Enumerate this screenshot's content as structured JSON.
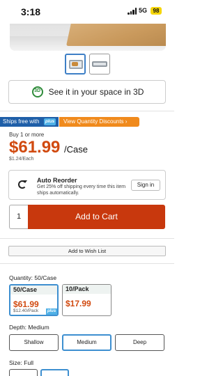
{
  "status_bar": {
    "time": "3:18",
    "network": "5G",
    "battery": "98"
  },
  "view3d": {
    "label": "See it in your space in 3D",
    "icon": "cube-3d-icon",
    "icon_text": "3D"
  },
  "shipping": {
    "ships_free_label": "Ships free with",
    "plus_label": "plus",
    "qty_discount_label": "View Quantity Discounts ›"
  },
  "pricing": {
    "buy_label": "Buy 1 or more",
    "price": "$61.99",
    "unit": "/Case",
    "each": "$1.24/Each"
  },
  "auto_reorder": {
    "title": "Auto Reorder",
    "description": "Get 25% off shipping every time this item ships automatically.",
    "sign_in_label": "Sign in"
  },
  "cart": {
    "quantity": "1",
    "add_to_cart_label": "Add to Cart"
  },
  "wish_list_label": "Add to Wish List",
  "quantity_options": {
    "label": "Quantity:",
    "selected_value": "50/Case",
    "options": [
      {
        "name": "50/Case",
        "price": "$61.99",
        "sub": "$12.40/Pack",
        "plus": "plus"
      },
      {
        "name": "10/Pack",
        "price": "$17.99",
        "sub": ""
      }
    ]
  },
  "depth_options": {
    "label": "Depth:",
    "selected_value": "Medium",
    "options": [
      "Shallow",
      "Medium",
      "Deep"
    ]
  },
  "size_options": {
    "label": "Size:",
    "selected_value": "Full"
  },
  "colors": {
    "price_orange": "#d14a10",
    "cart_red": "#c8380d",
    "plus_blue": "#4fb0e6",
    "ships_blue": "#1f5fa8",
    "discount_orange": "#f08a1c",
    "select_blue": "#3d8fd0"
  }
}
